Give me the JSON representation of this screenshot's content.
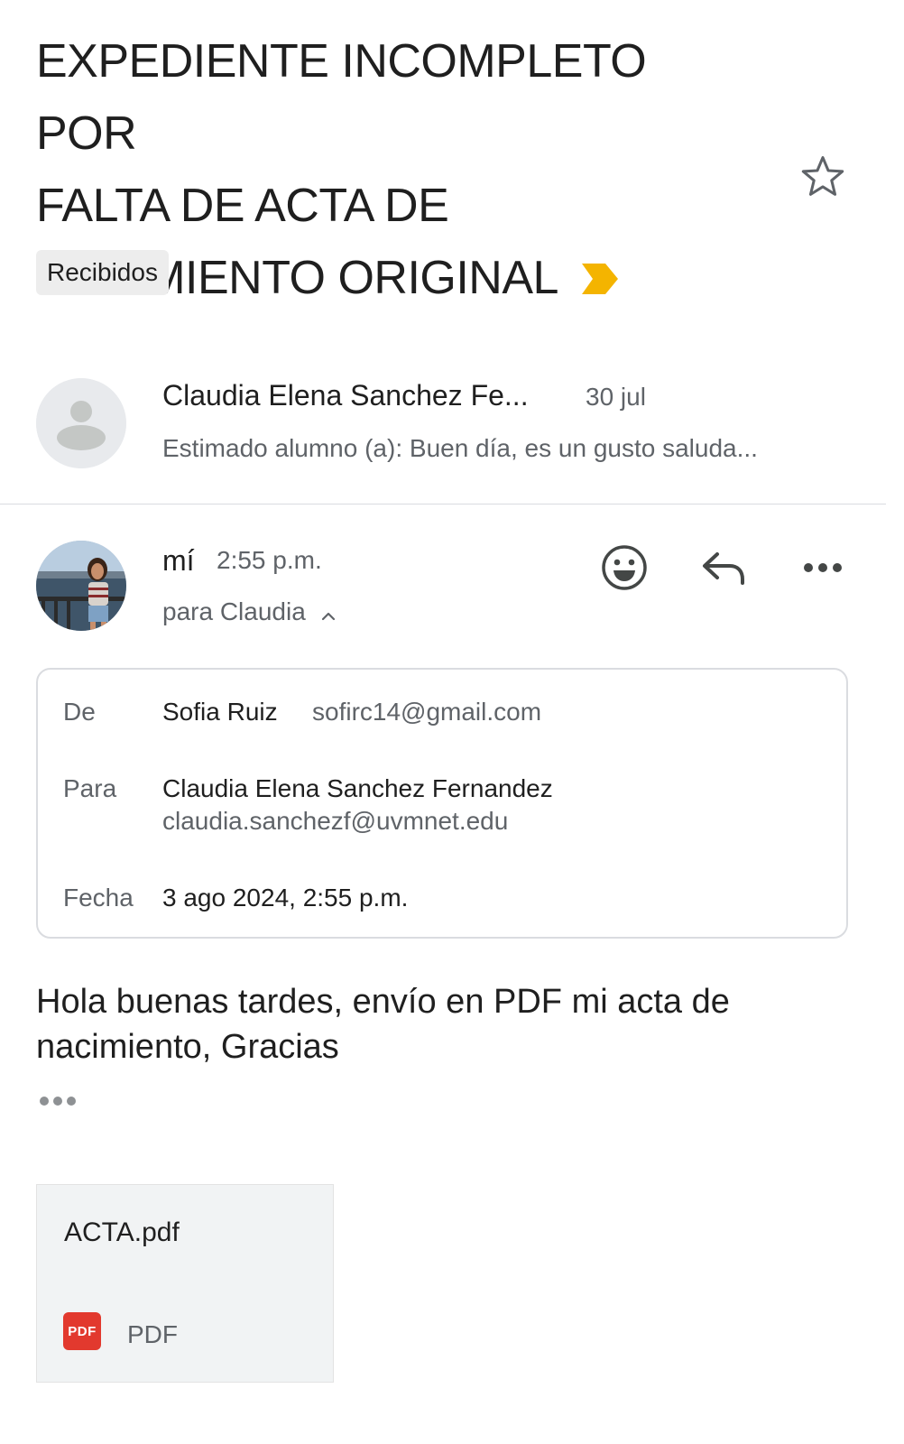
{
  "subject": {
    "line1": "EXPEDIENTE INCOMPLETO POR",
    "line2": "FALTA DE ACTA DE",
    "line3": "NACIMIENTO ORIGINAL",
    "important_icon": "important-marker-icon",
    "star_icon": "star-outline-icon"
  },
  "label_chip": "Recibidos",
  "messages": [
    {
      "sender": "Claudia Elena Sanchez Fe...",
      "date": "30 jul",
      "snippet": "Estimado alumno (a): Buen día, es un gusto saluda..."
    },
    {
      "sender": "mí",
      "time": "2:55 p.m.",
      "recipients": "para Claudia",
      "actions": [
        "emoji-reaction-icon",
        "reply-icon",
        "more-options-icon"
      ]
    }
  ],
  "details": {
    "from_label": "De",
    "from_name": "Sofia Ruiz",
    "from_email": "sofirc14@gmail.com",
    "to_label": "Para",
    "to_name": "Claudia Elena Sanchez Fernandez",
    "to_email": "claudia.sanchezf@uvmnet.edu",
    "date_label": "Fecha",
    "date_value": "3 ago 2024, 2:55 p.m."
  },
  "body": {
    "text": "Hola buenas tardes, envío en PDF mi acta de nacimiento, Gracias",
    "trimmed_content_icon": "show-trimmed-content-icon"
  },
  "attachment": {
    "filename": "ACTA.pdf",
    "badge": "PDF",
    "type": "PDF"
  },
  "colors": {
    "important": "#f4b400",
    "pdf_badge": "#e2392e",
    "secondary_text": "#5f6368"
  }
}
